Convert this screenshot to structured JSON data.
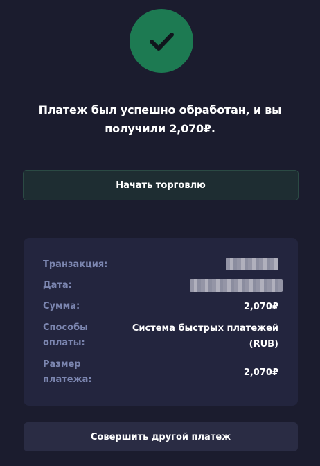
{
  "status": {
    "icon": "checkmark-icon",
    "color": "#1d7a52",
    "message_line1": "Платеж был успешно обработан, и вы",
    "message_line2": "получили 2,070₽."
  },
  "actions": {
    "start_trading": "Начать торговлю",
    "another_payment": "Совершить другой платеж"
  },
  "details": {
    "transaction_label": "Транзакция:",
    "date_label": "Дата:",
    "amount_label": "Сумма:",
    "amount_value": "2,070₽",
    "method_label_1": "Способы",
    "method_label_2": "оплаты:",
    "method_value_1": "Система быстрых платежей",
    "method_value_2": "(RUB)",
    "size_label_1": "Размер",
    "size_label_2": "платежа:",
    "size_value": "2,070₽"
  }
}
